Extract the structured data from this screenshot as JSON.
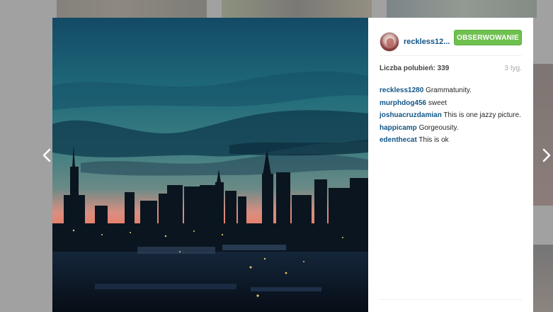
{
  "post": {
    "author": "reckless12...",
    "follow_label": "OBSERWOWANIE",
    "likes_text": "Liczba polubień: 339",
    "time_ago": "3 tyg."
  },
  "comments": [
    {
      "user": "reckless1280",
      "text": "Grammatunity."
    },
    {
      "user": "murphdog456",
      "text": "sweet"
    },
    {
      "user": "joshuacruzdamian",
      "text": "This is one jazzy picture."
    },
    {
      "user": "happicamp",
      "text": "Gorgeousity."
    },
    {
      "user": "edenthecat",
      "text": "This is ok"
    }
  ],
  "icons": {
    "prev": "chevron-left-icon",
    "next": "chevron-right-icon"
  },
  "colors": {
    "link": "#125688",
    "follow_button": "#70c050",
    "sky_top": "#1d5a6e",
    "sunset": "#e8806a"
  }
}
